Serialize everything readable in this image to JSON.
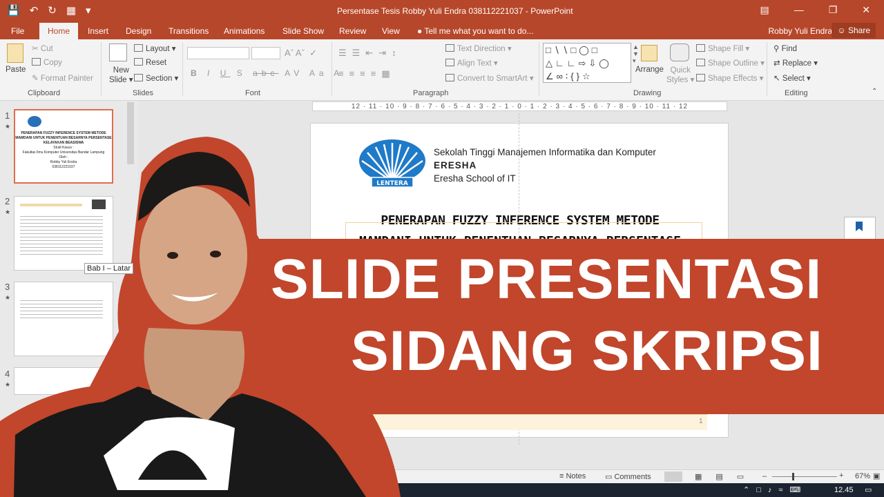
{
  "window": {
    "title": "Persentase Tesis  Robby Yuli Endra 038112221037 - PowerPoint"
  },
  "menu": {
    "tabs": [
      "File",
      "Home",
      "Insert",
      "Design",
      "Transitions",
      "Animations",
      "Slide Show",
      "Review",
      "View"
    ],
    "tell_me": "Tell me what you want to do...",
    "user": "Robby Yuli Endra",
    "share": "Share"
  },
  "ribbon": {
    "clipboard": {
      "paste": "Paste",
      "cut": "Cut",
      "copy": "Copy",
      "format_painter": "Format Painter",
      "label": "Clipboard"
    },
    "slides": {
      "new_slide_line1": "New",
      "new_slide_line2": "Slide",
      "layout": "Layout",
      "reset": "Reset",
      "section": "Section",
      "label": "Slides"
    },
    "font": {
      "label": "Font",
      "bold": "B",
      "italic": "I",
      "underline": "U",
      "shadow": "S",
      "strike": "abc",
      "spacing": "AV",
      "case": "Aa",
      "color": "A"
    },
    "paragraph": {
      "text_direction": "Text Direction",
      "align_text": "Align Text",
      "convert_smartart": "Convert to SmartArt",
      "label": "Paragraph"
    },
    "drawing": {
      "arrange": "Arrange",
      "quick_styles_line1": "Quick",
      "quick_styles_line2": "Styles",
      "shape_fill": "Shape Fill",
      "shape_outline": "Shape Outline",
      "shape_effects": "Shape Effects",
      "label": "Drawing"
    },
    "editing": {
      "find": "Find",
      "replace": "Replace",
      "select": "Select",
      "label": "Editing"
    }
  },
  "thumbnails": [
    {
      "num": "1",
      "lines": [
        "PENERAPAN FUZZY INFERENCE SYSTEM METODE",
        "MAMDANI UNTUK PENENTUAN BESARNYA PERSENTASE",
        "KELAYAKAN BEASISWA",
        "Studi Kasus :",
        "Fakultas Ilmu Komputer Universitas Bandar Lampung",
        "Oleh :",
        "Robby Yuli Endra",
        "038112221037"
      ]
    },
    {
      "num": "2",
      "tooltip": "Bab I – Latar"
    },
    {
      "num": "3"
    },
    {
      "num": "4"
    }
  ],
  "ruler": {
    "text": "12 · 11 · 10 · 9 · 8 · 7 · 6 · 5 · 4 · 3 · 2 · 1 · 0 · 1 · 2 · 3 · 4 · 5 · 6 · 7 · 8 · 9 · 10 · 11 · 12"
  },
  "slide": {
    "institution": "Sekolah Tinggi Manajemen Informatika dan Komputer",
    "brand": "ERESHA",
    "school": "Eresha School of IT",
    "logo_text": "LENTERA",
    "title_line1": "PENERAPAN FUZZY INFERENCE SYSTEM METODE",
    "title_line2": "MAMDANI UNTUK PENENTUAN BESARNYA PERSENTASE",
    "page_num": "1"
  },
  "banner": {
    "line1": "SLIDE PRESENTASI",
    "line2": "SIDANG SKRIPSI",
    "color": "#c1462b"
  },
  "status": {
    "notes": "Notes",
    "comments": "Comments",
    "zoom": "67%"
  },
  "taskbar": {
    "time": "12.45"
  },
  "colors": {
    "accent": "#b7472a"
  }
}
